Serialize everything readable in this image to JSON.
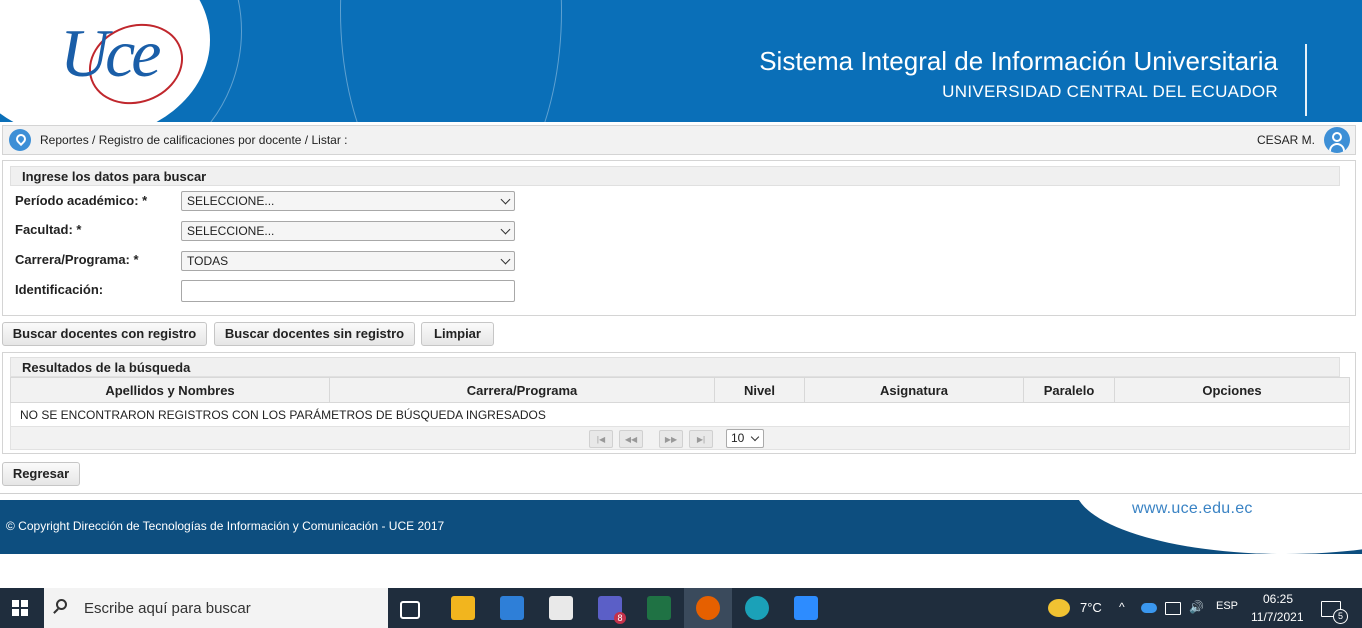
{
  "header": {
    "logo_text": "Uce",
    "title": "Sistema Integral de Información Universitaria",
    "subtitle": "UNIVERSIDAD CENTRAL DEL ECUADOR"
  },
  "breadcrumb": {
    "path": "Reportes / Registro de calificaciones por docente / Listar :",
    "user": "CESAR M."
  },
  "search_panel": {
    "title": "Ingrese los datos para buscar",
    "fields": {
      "periodo": {
        "label": "Período académico: *",
        "value": "SELECCIONE..."
      },
      "facultad": {
        "label": "Facultad: *",
        "value": "SELECCIONE..."
      },
      "carrera": {
        "label": "Carrera/Programa: *",
        "value": "TODAS"
      },
      "identificacion": {
        "label": "Identificación:",
        "value": ""
      }
    }
  },
  "buttons": {
    "con_registro": "Buscar docentes con registro",
    "sin_registro": "Buscar docentes sin registro",
    "limpiar": "Limpiar",
    "regresar": "Regresar"
  },
  "results": {
    "title": "Resultados de la búsqueda",
    "columns": [
      "Apellidos y Nombres",
      "Carrera/Programa",
      "Nivel",
      "Asignatura",
      "Paralelo",
      "Opciones"
    ],
    "empty_message": "NO SE ENCONTRARON REGISTROS CON LOS PARÁMETROS DE BÚSQUEDA INGRESADOS",
    "rows_per_page": "10"
  },
  "footer": {
    "copyright": "© Copyright Dirección de Tecnologías de Información y Comunicación - UCE 2017",
    "url": "www.uce.edu.ec"
  },
  "taskbar": {
    "search_placeholder": "Escribe aquí para buscar",
    "teams_badge": "8",
    "temperature": "7°C",
    "language": "ESP",
    "time": "06:25",
    "date": "11/7/2021",
    "notifications": "5"
  },
  "colors": {
    "header_blue": "#0a6fb8",
    "footer_blue": "#0d4e7f",
    "taskbar": "#1f2d3d"
  }
}
